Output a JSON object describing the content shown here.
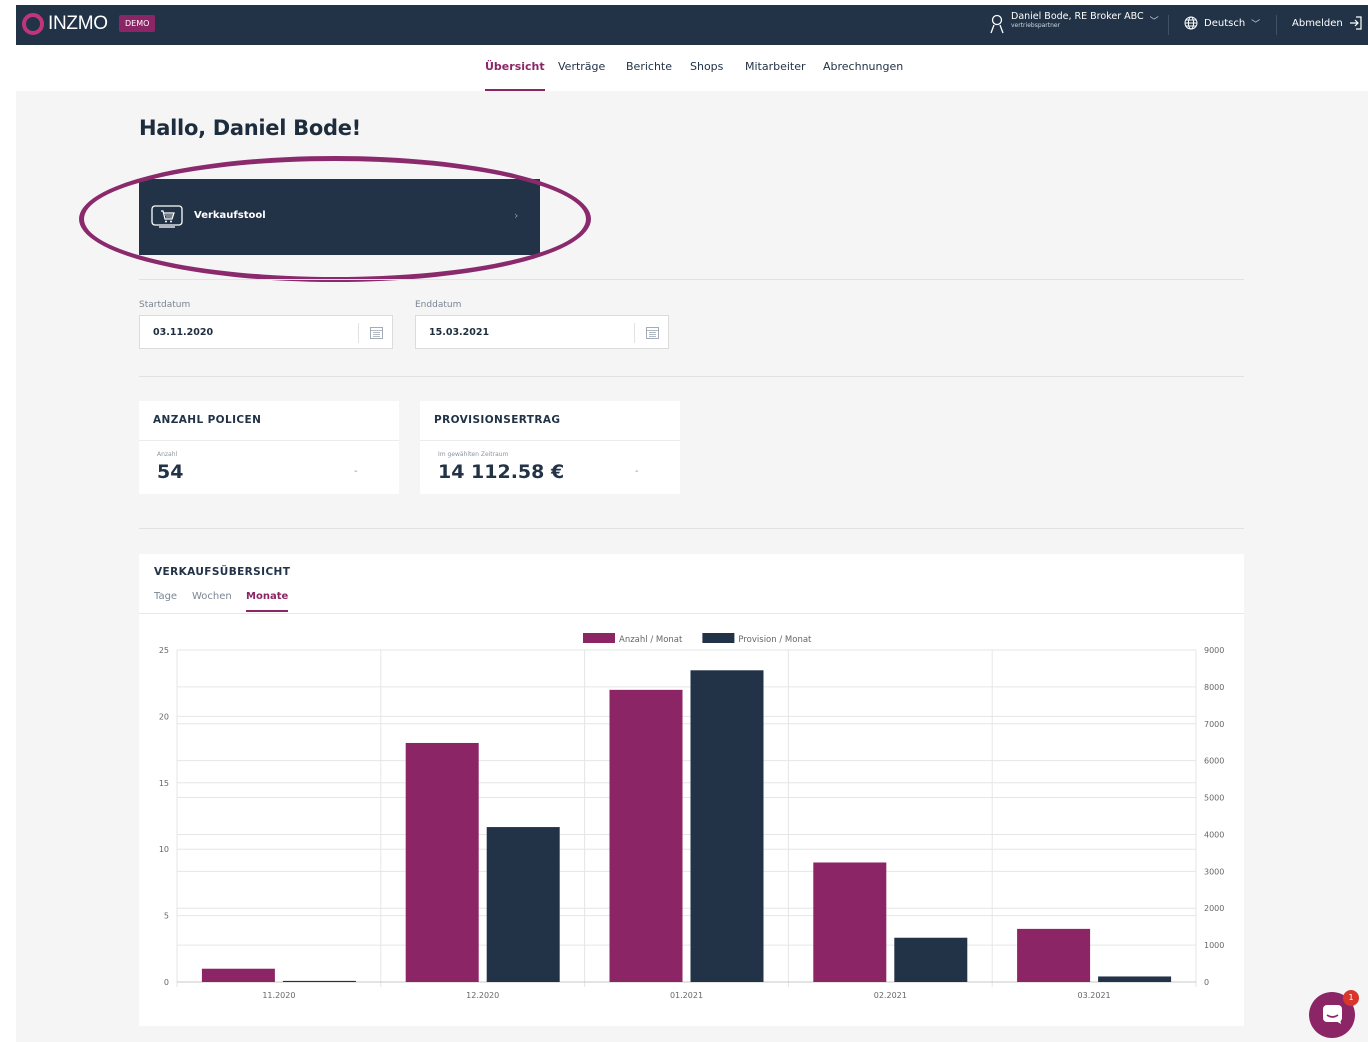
{
  "header": {
    "logo_text": "INZMO",
    "badge": "DEMO",
    "user_name": "Daniel Bode, RE Broker ABC",
    "user_role": "vertriebspartner",
    "language": "Deutsch",
    "logout": "Abmelden"
  },
  "nav": {
    "tabs": [
      {
        "label": "Übersicht",
        "active": true
      },
      {
        "label": "Verträge",
        "active": false
      },
      {
        "label": "Berichte",
        "active": false
      },
      {
        "label": "Shops",
        "active": false
      },
      {
        "label": "Mitarbeiter",
        "active": false
      },
      {
        "label": "Abrechnungen",
        "active": false
      }
    ]
  },
  "main": {
    "greeting": "Hallo, Daniel Bode!",
    "sales_tool": {
      "label": "Verkaufstool",
      "arrow": "›"
    },
    "start_date": {
      "label": "Startdatum",
      "value": "03.11.2020"
    },
    "end_date": {
      "label": "Enddatum",
      "value": "15.03.2021"
    },
    "policies": {
      "title": "ANZAHL POLICEN",
      "small": "Anzahl",
      "value": "54",
      "trend": "-"
    },
    "commission": {
      "title": "PROVISIONSERTRAG",
      "small": "Im gewählten Zeitraum",
      "value": "14 112.58 €",
      "trend": "-"
    },
    "sales_overview": {
      "title": "VERKAUFSÜBERSICHT",
      "tabs": [
        {
          "label": "Tage",
          "active": false
        },
        {
          "label": "Wochen",
          "active": false
        },
        {
          "label": "Monate",
          "active": true
        }
      ]
    }
  },
  "chart_data": {
    "type": "bar",
    "categories": [
      "11.2020",
      "12.2020",
      "01.2021",
      "02.2021",
      "03.2021"
    ],
    "series": [
      {
        "name": "Anzahl / Monat",
        "axis": "left",
        "color": "#8c2566",
        "values": [
          1,
          18,
          22,
          9,
          4
        ]
      },
      {
        "name": "Provision / Monat",
        "axis": "right",
        "color": "#223347",
        "values": [
          30,
          4200,
          8450,
          1200,
          150
        ]
      }
    ],
    "y_left": {
      "range": [
        0,
        25
      ],
      "ticks": [
        0,
        5,
        10,
        15,
        20,
        25
      ]
    },
    "y_right": {
      "range": [
        0,
        9000
      ],
      "ticks": [
        0,
        1000,
        2000,
        3000,
        4000,
        5000,
        6000,
        7000,
        8000,
        9000
      ]
    },
    "grid": true,
    "legend_position": "top-center"
  },
  "chat": {
    "badge_count": "1"
  },
  "colors": {
    "primary": "#8c2566",
    "navy": "#223347",
    "annotation": "#8a2a6d"
  },
  "annotation": {
    "type": "oval",
    "target": "sales-tool-card"
  }
}
